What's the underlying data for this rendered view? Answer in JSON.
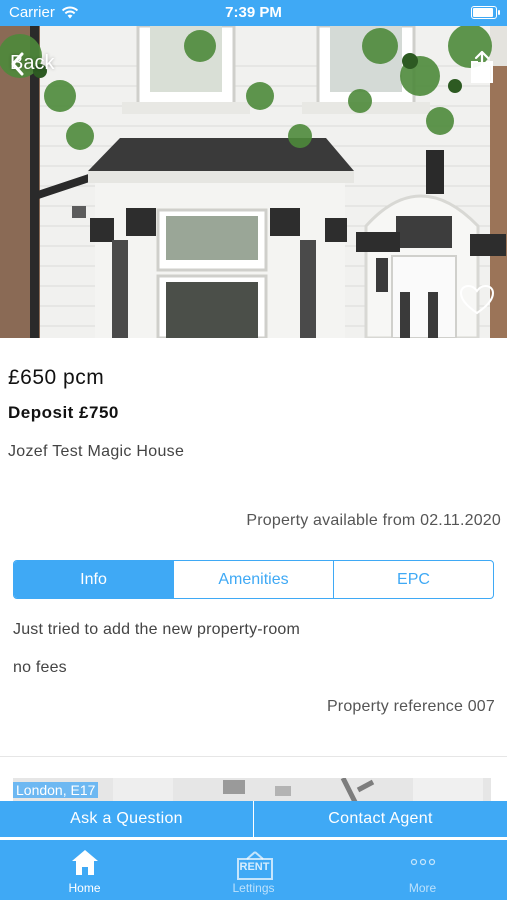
{
  "status_bar": {
    "carrier": "Carrier",
    "time": "7:39 PM"
  },
  "nav": {
    "back_label": "Back"
  },
  "property": {
    "price": "£650 pcm",
    "deposit": "Deposit £750",
    "name": "Jozef Test Magic House",
    "available": "Property available from 02.11.2020",
    "description": "Just tried to add the new property-room",
    "fees": "no fees",
    "reference": "Property reference 007"
  },
  "tabs": [
    {
      "label": "Info",
      "active": true
    },
    {
      "label": "Amenities",
      "active": false
    },
    {
      "label": "EPC",
      "active": false
    }
  ],
  "map": {
    "label": "London, E17"
  },
  "actions": {
    "ask": "Ask a Question",
    "contact": "Contact Agent"
  },
  "tabbar": {
    "home": "Home",
    "lettings": "Lettings",
    "lettings_badge": "RENT",
    "more": "More"
  },
  "colors": {
    "accent": "#3fa9f5",
    "white": "#ffffff"
  },
  "icons": {
    "back": "chevron-left-icon",
    "share": "share-icon",
    "favorite": "heart-icon",
    "home": "home-icon",
    "lettings": "rent-sign-icon",
    "more": "ellipsis-icon",
    "wifi": "wifi-icon",
    "battery": "battery-icon"
  }
}
